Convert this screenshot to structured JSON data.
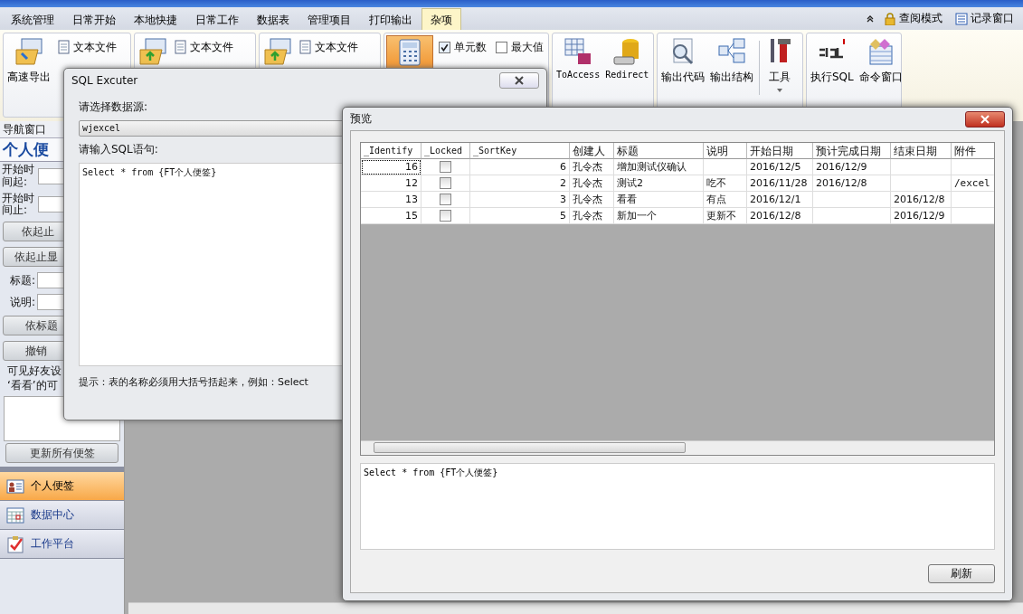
{
  "ribbon_tabs": [
    {
      "label": "系统管理",
      "selected": false
    },
    {
      "label": "日常开始",
      "selected": false
    },
    {
      "label": "本地快捷",
      "selected": false
    },
    {
      "label": "日常工作",
      "selected": false
    },
    {
      "label": "数据表",
      "selected": false
    },
    {
      "label": "管理项目",
      "selected": false
    },
    {
      "label": "打印输出",
      "selected": false
    },
    {
      "label": "杂项",
      "selected": true
    }
  ],
  "quick_links": [
    "查阅模式",
    "记录窗口"
  ],
  "ribbon_groups": [
    {
      "items": [
        {
          "kind": "large",
          "label": "高速导出"
        },
        {
          "kind": "small",
          "label": "文本文件"
        }
      ]
    },
    {
      "items": [
        {
          "kind": "icon"
        },
        {
          "kind": "small",
          "label": "文本文件"
        }
      ]
    },
    {
      "items": [
        {
          "kind": "icon"
        },
        {
          "kind": "small",
          "label": "文本文件"
        }
      ]
    },
    {
      "items": [
        {
          "kind": "icon"
        },
        {
          "kind": "checkbox",
          "label": "单元数",
          "checked": true
        },
        {
          "kind": "checkbox",
          "label": "最大值",
          "checked": false
        }
      ]
    },
    {
      "items": [
        {
          "kind": "large",
          "label": "ToAccess"
        },
        {
          "kind": "large",
          "label": "Redirect"
        }
      ]
    },
    {
      "items": [
        {
          "kind": "large",
          "label": "输出代码"
        },
        {
          "kind": "large",
          "label": "输出结构"
        },
        {
          "kind": "dropdown",
          "label": "工具"
        }
      ]
    },
    {
      "items": [
        {
          "kind": "large",
          "label": "执行SQL"
        },
        {
          "kind": "large",
          "label": "命令窗口"
        }
      ]
    }
  ],
  "nav_panel": {
    "header": "导航窗口",
    "title": "个人便",
    "fields": [
      "开始时间起:",
      "开始时间止:"
    ],
    "buttons": [
      "依起止",
      "依起止显"
    ],
    "filters": [
      "标题:",
      "说明:"
    ],
    "buttons_2": [
      "依标题",
      "撤销"
    ],
    "note_lines": [
      "可见好友设",
      "‘看看’的可"
    ],
    "update_button": "更新所有便签"
  },
  "nav_items": [
    {
      "label": "个人便签",
      "selected": true
    },
    {
      "label": "数据中心",
      "selected": false
    },
    {
      "label": "工作平台",
      "selected": false
    }
  ],
  "sql_dialog": {
    "title": "SQL Excuter",
    "source_label": "请选择数据源:",
    "source": "wjexcel",
    "sql_label": "请输入SQL语句:",
    "sql": "Select * from {FT个人便签}",
    "hint": "提示：表的名称必须用大括号括起来，例如：Select"
  },
  "preview": {
    "title": "预览",
    "columns": [
      "_Identify",
      "_Locked",
      "_SortKey",
      "创建人",
      "标题",
      "说明",
      "开始日期",
      "预计完成日期",
      "结束日期",
      "附件"
    ],
    "rows": [
      {
        "identify": "16",
        "locked": false,
        "sort_key": "6",
        "creator": "孔令杰",
        "title": "增加测试仪确认",
        "start": "2016/12/5",
        "planned": "2016/12/9"
      },
      {
        "identify": "12",
        "locked": false,
        "sort_key": "2",
        "creator": "孔令杰",
        "title": "测试2",
        "note": "吃不",
        "start": "2016/11/28",
        "planned": "2016/12/8",
        "attachment": "/excel"
      },
      {
        "identify": "13",
        "locked": false,
        "sort_key": "3",
        "creator": "孔令杰",
        "title": "看看",
        "note": "有点",
        "start": "2016/12/1",
        "end": "2016/12/8"
      },
      {
        "identify": "15",
        "locked": false,
        "sort_key": "5",
        "creator": "孔令杰",
        "title": "新加一个",
        "note": "更新不",
        "start": "2016/12/8",
        "end": "2016/12/9"
      }
    ],
    "sql": "Select * from {FT个人便签}",
    "refresh_button": "刷新"
  }
}
